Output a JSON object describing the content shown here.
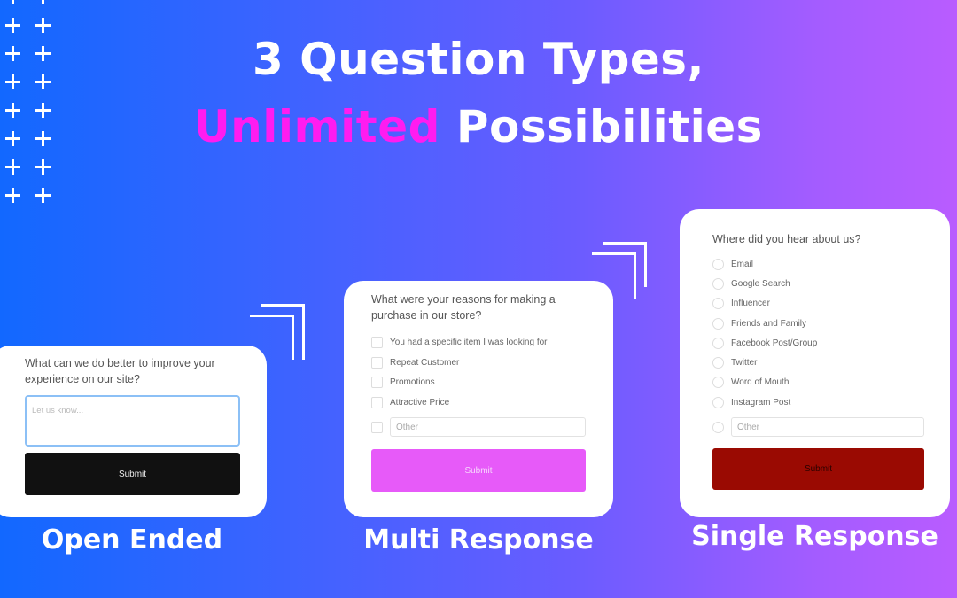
{
  "headline": {
    "line1": "3 Question Types,",
    "accent_word": "Unlimited",
    "line2_rest": "Possibilities"
  },
  "colors": {
    "accent": "#ff1cf0",
    "multi_submit": "#e75af9",
    "single_submit": "#9a0a02",
    "open_submit": "#111111"
  },
  "open_ended": {
    "question": "What can we do better to improve your experience on our site?",
    "textarea_placeholder": "Let us know...",
    "submit_label": "Submit",
    "type_label": "Open Ended"
  },
  "multi_response": {
    "question": "What were your reasons for making a purchase in our store?",
    "options": [
      "You had a specific item I was looking for",
      "Repeat Customer",
      "Promotions",
      "Attractive Price"
    ],
    "other_placeholder": "Other",
    "submit_label": "Submit",
    "type_label": "Multi Response"
  },
  "single_response": {
    "question": "Where did you hear about us?",
    "options": [
      "Email",
      "Google Search",
      "Influencer",
      "Friends and Family",
      "Facebook Post/Group",
      "Twitter",
      "Word of Mouth",
      "Instagram Post"
    ],
    "other_placeholder": "Other",
    "submit_label": "Submit",
    "type_label": "Single Response"
  }
}
